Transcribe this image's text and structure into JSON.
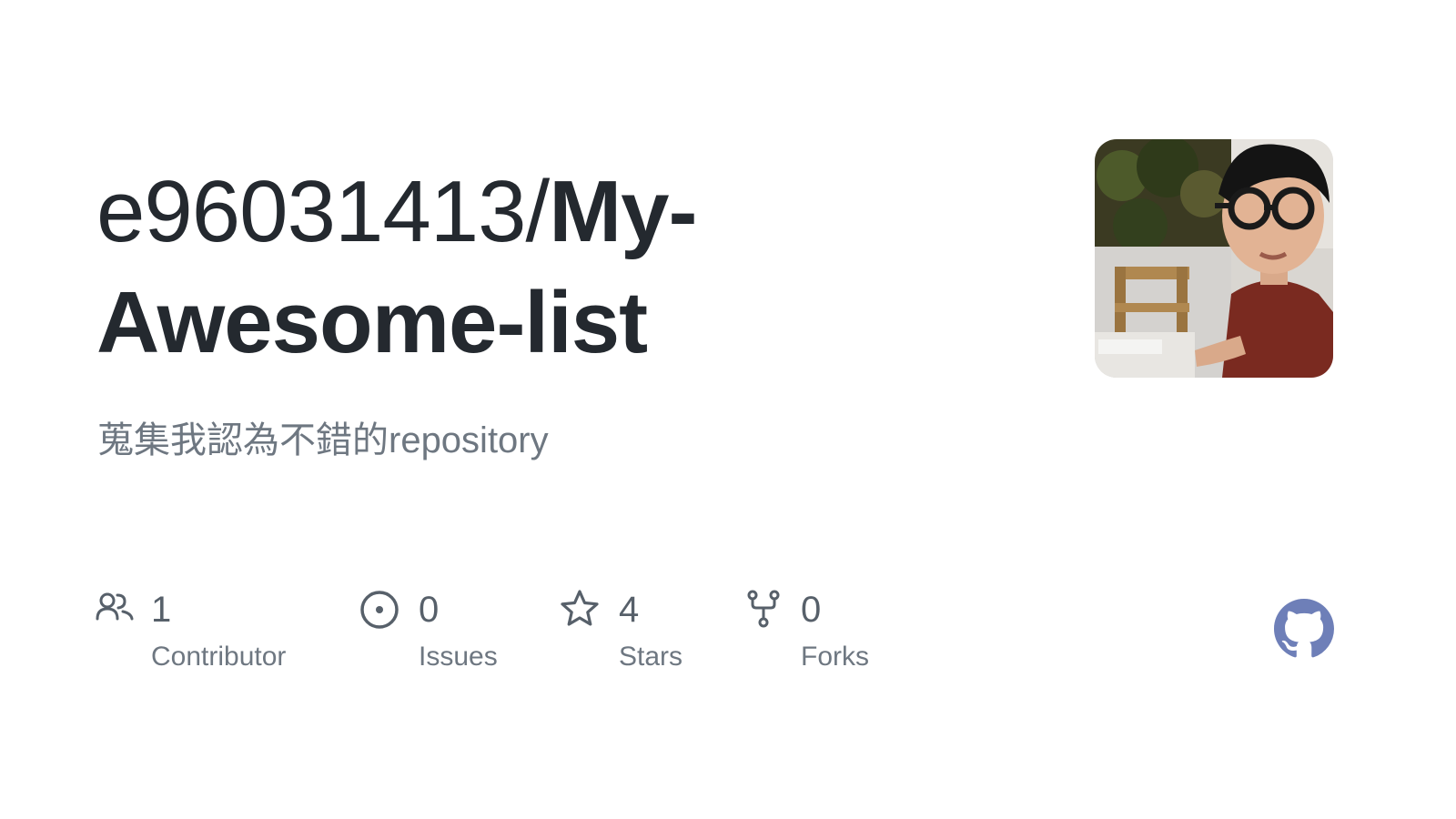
{
  "repo": {
    "owner": "e96031413/",
    "name": "My-Awesome-list",
    "description": "蒐集我認為不錯的repository"
  },
  "stats": [
    {
      "value": "1",
      "label": "Contributor",
      "icon": "people-icon"
    },
    {
      "value": "0",
      "label": "Issues",
      "icon": "issue-opened-icon"
    },
    {
      "value": "4",
      "label": "Stars",
      "icon": "star-icon"
    },
    {
      "value": "0",
      "label": "Forks",
      "icon": "repo-forked-icon"
    }
  ],
  "brand": {
    "icon": "github-mark-icon",
    "color": "#6e7fb8"
  },
  "colors": {
    "text": "#24292f",
    "muted": "#6e7781",
    "icon": "#57606a"
  }
}
